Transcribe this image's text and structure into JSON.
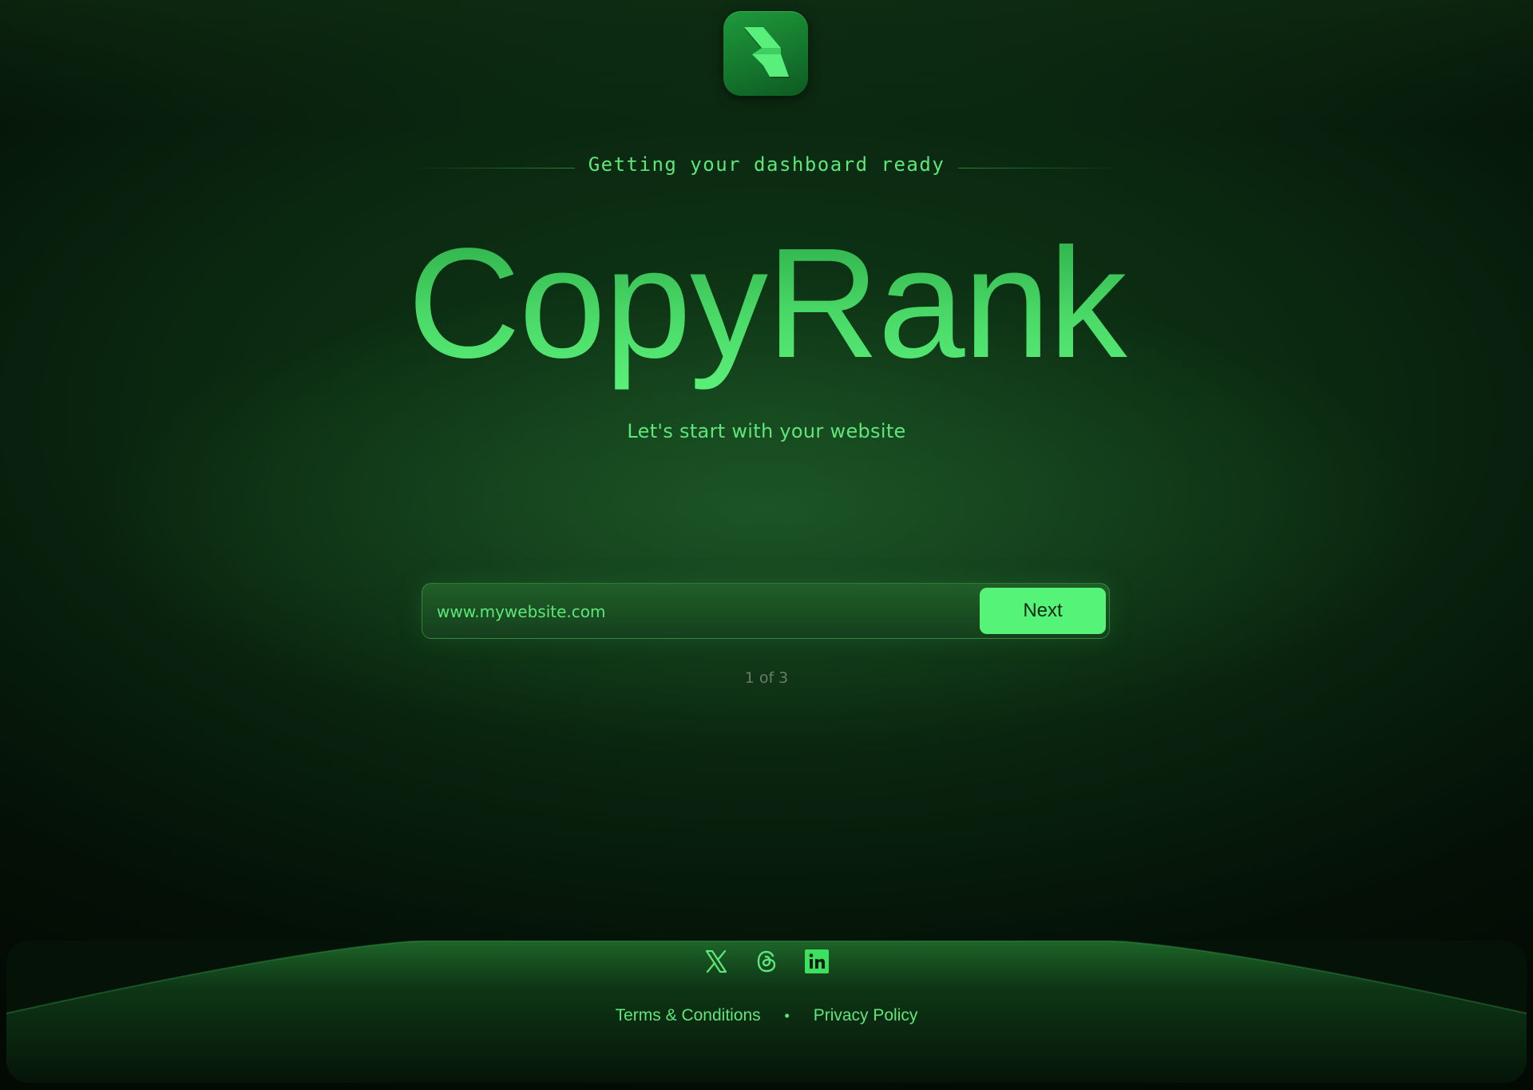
{
  "header": {
    "logo_icon": "copyrank-logo-icon",
    "tagline": "Getting your dashboard ready"
  },
  "hero": {
    "brand_name": "CopyRank",
    "subtitle": "Let's start with your website"
  },
  "form": {
    "url_value": "www.mywebsite.com",
    "url_placeholder": "www.mywebsite.com",
    "next_label": "Next"
  },
  "progress": {
    "step_text": "1 of 3",
    "current": 1,
    "total": 3
  },
  "footer": {
    "social_icons": [
      "x-icon",
      "threads-icon",
      "linkedin-icon"
    ],
    "terms_label": "Terms & Conditions",
    "separator": "•",
    "privacy_label": "Privacy Policy"
  },
  "colors": {
    "accent": "#56f379",
    "accent_text": "#5fe67a",
    "background": "#0a2710",
    "muted": "#6b7c6d"
  }
}
